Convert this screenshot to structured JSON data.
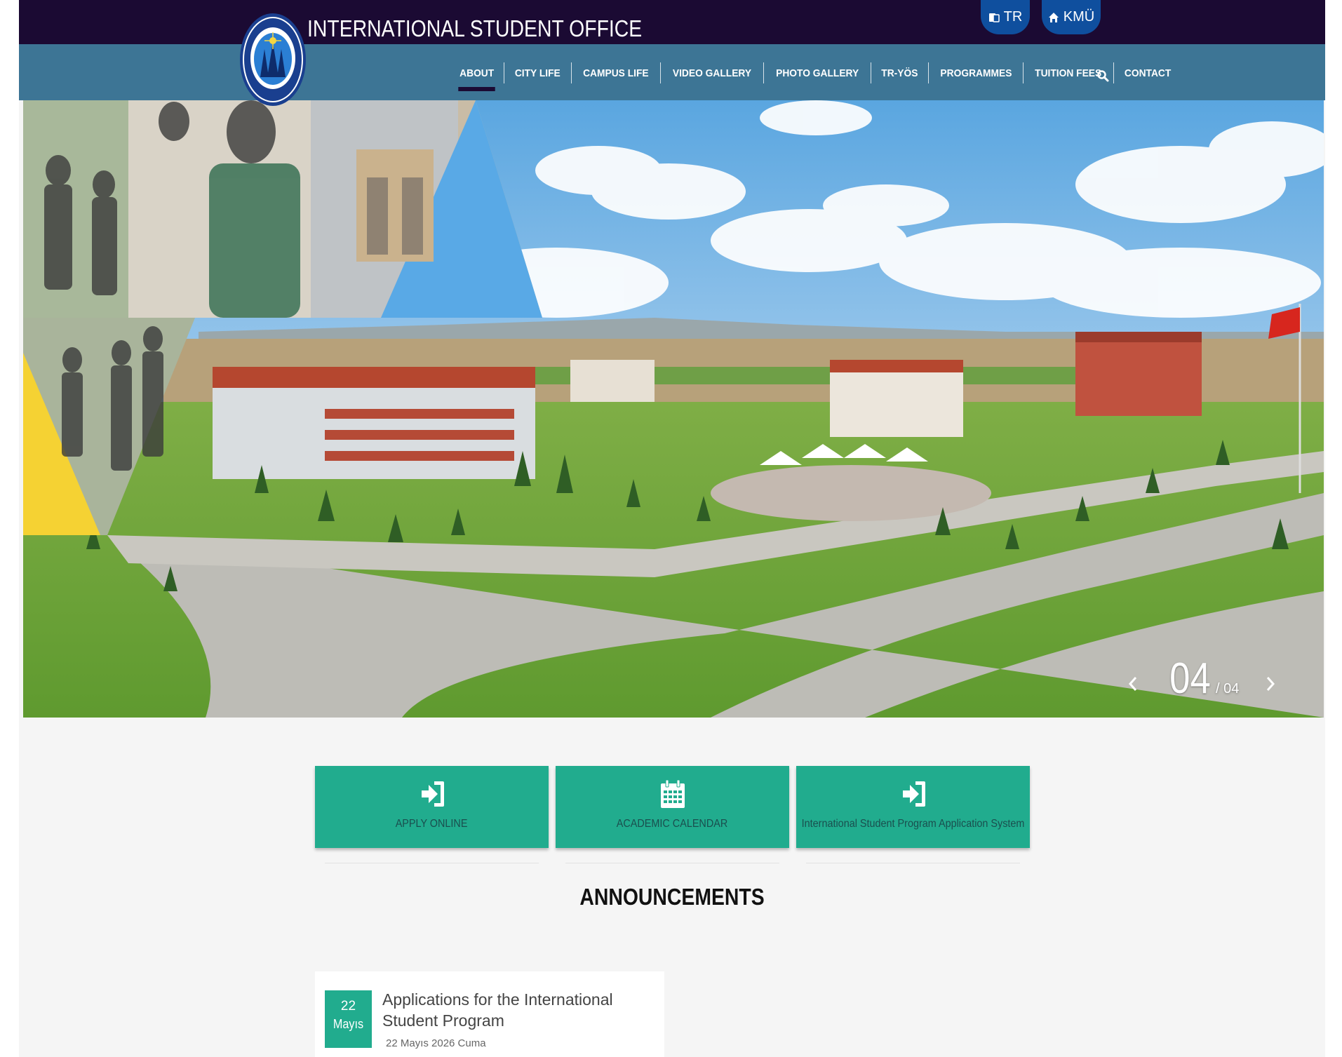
{
  "header": {
    "site_title": "INTERNATIONAL STUDENT OFFICE",
    "lang_button": "TR",
    "home_button": "KMÜ",
    "brand_dark": "#1b0a33",
    "brand_nav": "#3d7595"
  },
  "nav": {
    "items": [
      "ABOUT",
      "CITY LIFE",
      "CAMPUS LIFE",
      "VIDEO GALLERY",
      "PHOTO GALLERY",
      "TR-YÖS",
      "PROGRAMMES",
      "TUITION FEES",
      "CONTACT"
    ],
    "active": "ABOUT",
    "search_icon": "search-icon"
  },
  "slider": {
    "current": "04",
    "total": "/ 04",
    "prev_icon": "chevron-left-icon",
    "next_icon": "chevron-right-icon"
  },
  "actions": [
    {
      "label": "APPLY ONLINE",
      "icon": "sign-in-icon"
    },
    {
      "label": "ACADEMIC CALENDAR",
      "icon": "calendar-icon"
    },
    {
      "label": "International Student Program Application System",
      "icon": "sign-in-icon"
    }
  ],
  "announcements": {
    "title": "ANNOUNCEMENTS",
    "items": [
      {
        "day": "22",
        "month": "Mayıs",
        "title": "Applications for the International Student Program",
        "date": "22 Mayıs 2026 Cuma"
      }
    ]
  },
  "accent_color": "#21ac8e"
}
